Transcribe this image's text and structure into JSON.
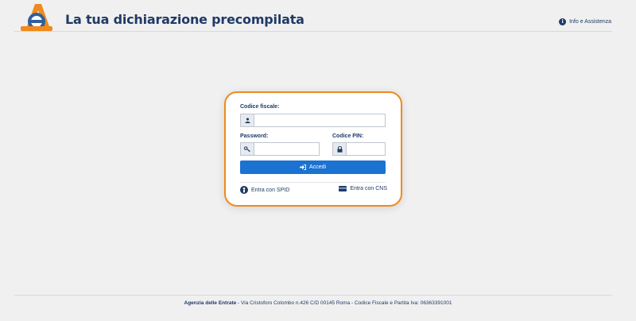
{
  "header": {
    "title": "La tua dichiarazione precompilata",
    "help_label": "Info e Assistenza"
  },
  "login": {
    "codice_fiscale_label": "Codice fiscale:",
    "codice_fiscale_value": "",
    "password_label": "Password:",
    "password_value": "",
    "pin_label": "Codice PIN:",
    "pin_value": "",
    "submit_label": "Accedi",
    "spid_label": "Entra con SPID",
    "cns_label": "Entra con CNS"
  },
  "footer": {
    "org_name": "Agenzia delle Entrate",
    "address": " - Via Cristoforo Colombo n.426 C/D 00145 Roma - Codice Fiscale e Partita Iva: 06363391001"
  },
  "colors": {
    "brand_blue": "#1f3a66",
    "button_blue": "#1b72d1",
    "card_border": "#f08a1c"
  },
  "icons": [
    "agenzia-entrate-logo",
    "info-icon",
    "user-icon",
    "key-icon",
    "lock-icon",
    "sign-in-icon",
    "spid-icon",
    "cns-card-icon"
  ]
}
